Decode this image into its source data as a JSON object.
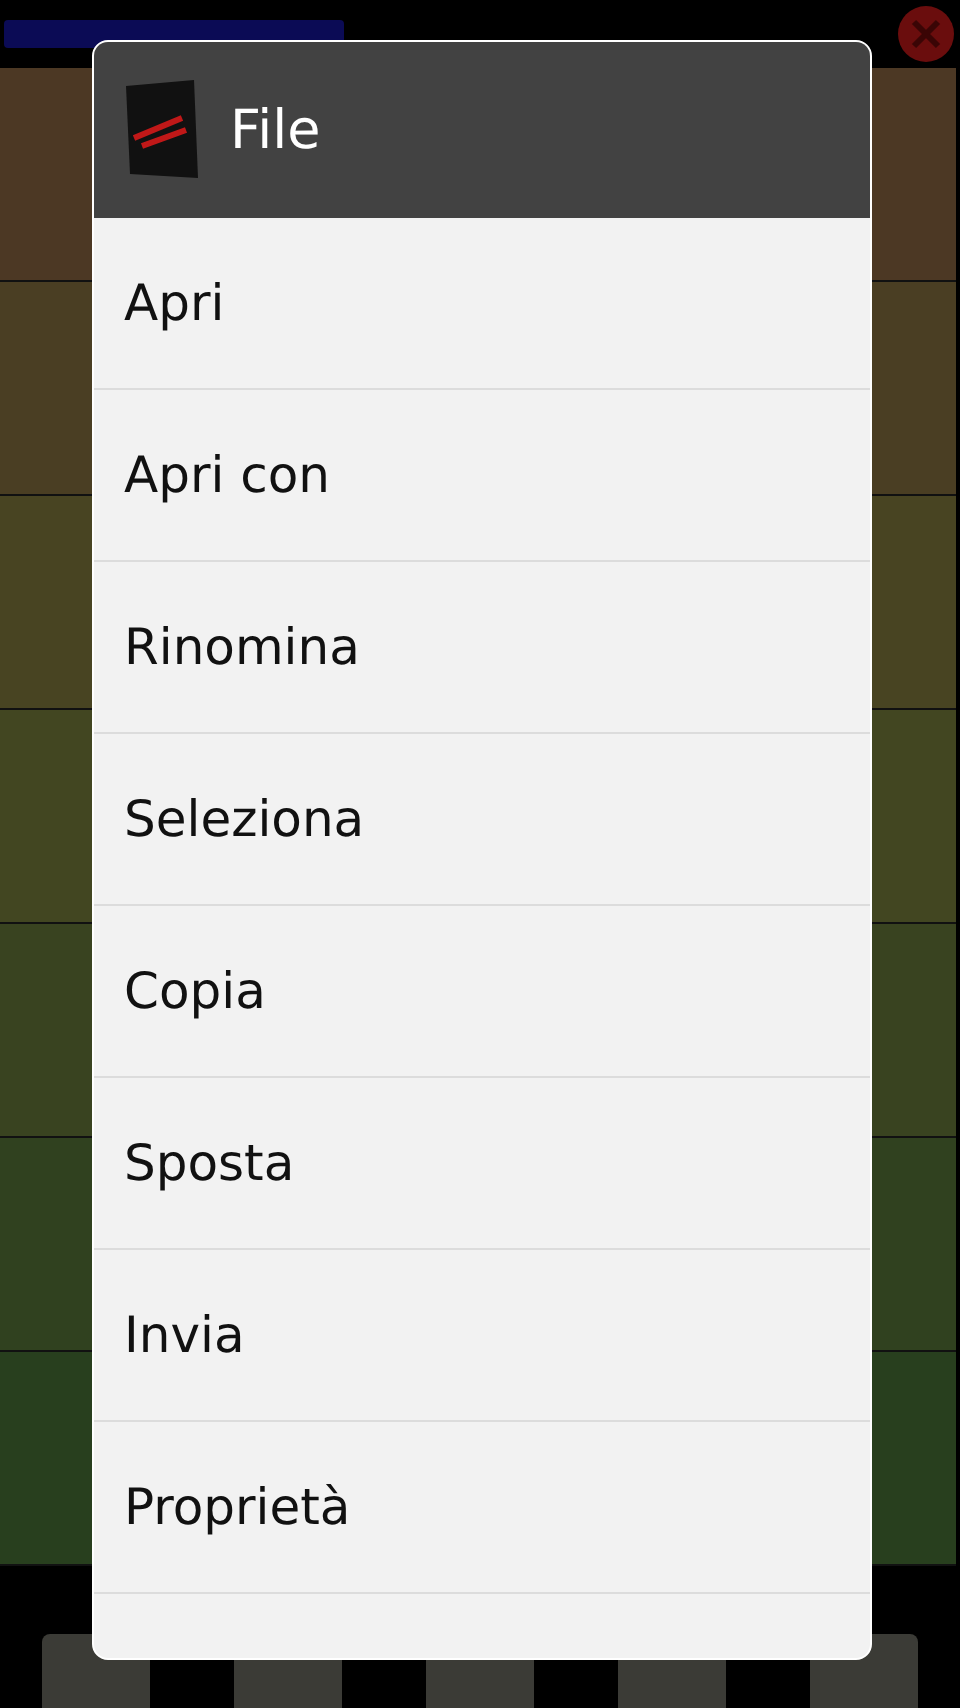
{
  "dialog": {
    "title": "File",
    "items": [
      {
        "label": "Apri"
      },
      {
        "label": "Apri con"
      },
      {
        "label": "Rinomina"
      },
      {
        "label": "Seleziona"
      },
      {
        "label": "Copia"
      },
      {
        "label": "Sposta"
      },
      {
        "label": "Invia"
      },
      {
        "label": "Proprietà"
      }
    ]
  }
}
